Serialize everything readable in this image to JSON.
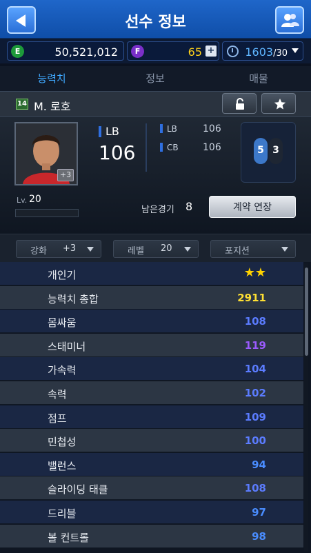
{
  "header": {
    "title": "선수 정보"
  },
  "currency": {
    "e_value": "50,521,012",
    "f_value": "65",
    "energy_value": "1603",
    "energy_max": "/30",
    "e_icon": "E",
    "f_icon": "F"
  },
  "tabs": [
    {
      "label": "능력치"
    },
    {
      "label": "정보"
    },
    {
      "label": "매물"
    }
  ],
  "player": {
    "season_badge": "14",
    "name": "M. 로호",
    "enhance_badge": "+3",
    "position": "LB",
    "overall": "106",
    "alt_positions": [
      {
        "pos": "LB",
        "value": "106"
      },
      {
        "pos": "CB",
        "value": "106"
      }
    ],
    "feet": {
      "left": "5",
      "right": "3"
    },
    "level_label": "Lv.",
    "level": "20",
    "remaining_label": "남은경기",
    "remaining": "8",
    "extend_label": "계약 연장"
  },
  "filters": [
    {
      "label": "강화",
      "value": "+3"
    },
    {
      "label": "레벨",
      "value": "20"
    },
    {
      "label": "포지션",
      "value": ""
    }
  ],
  "stats": [
    {
      "name": "개인기",
      "value": "★★",
      "color": "#ffd200"
    },
    {
      "name": "능력치 총합",
      "value": "2911",
      "color": "#ffe033"
    },
    {
      "name": "몸싸움",
      "value": "108",
      "color": "#5b7cff"
    },
    {
      "name": "스태미너",
      "value": "119",
      "color": "#9b5bff"
    },
    {
      "name": "가속력",
      "value": "104",
      "color": "#5b7cff"
    },
    {
      "name": "속력",
      "value": "102",
      "color": "#5b7cff"
    },
    {
      "name": "점프",
      "value": "109",
      "color": "#5b7cff"
    },
    {
      "name": "민첩성",
      "value": "100",
      "color": "#5b7cff"
    },
    {
      "name": "밸런스",
      "value": "94",
      "color": "#4a8dff"
    },
    {
      "name": "슬라이딩 태클",
      "value": "108",
      "color": "#5b7cff"
    },
    {
      "name": "드리블",
      "value": "97",
      "color": "#4a8dff"
    },
    {
      "name": "볼 컨트롤",
      "value": "98",
      "color": "#4a8dff"
    }
  ]
}
